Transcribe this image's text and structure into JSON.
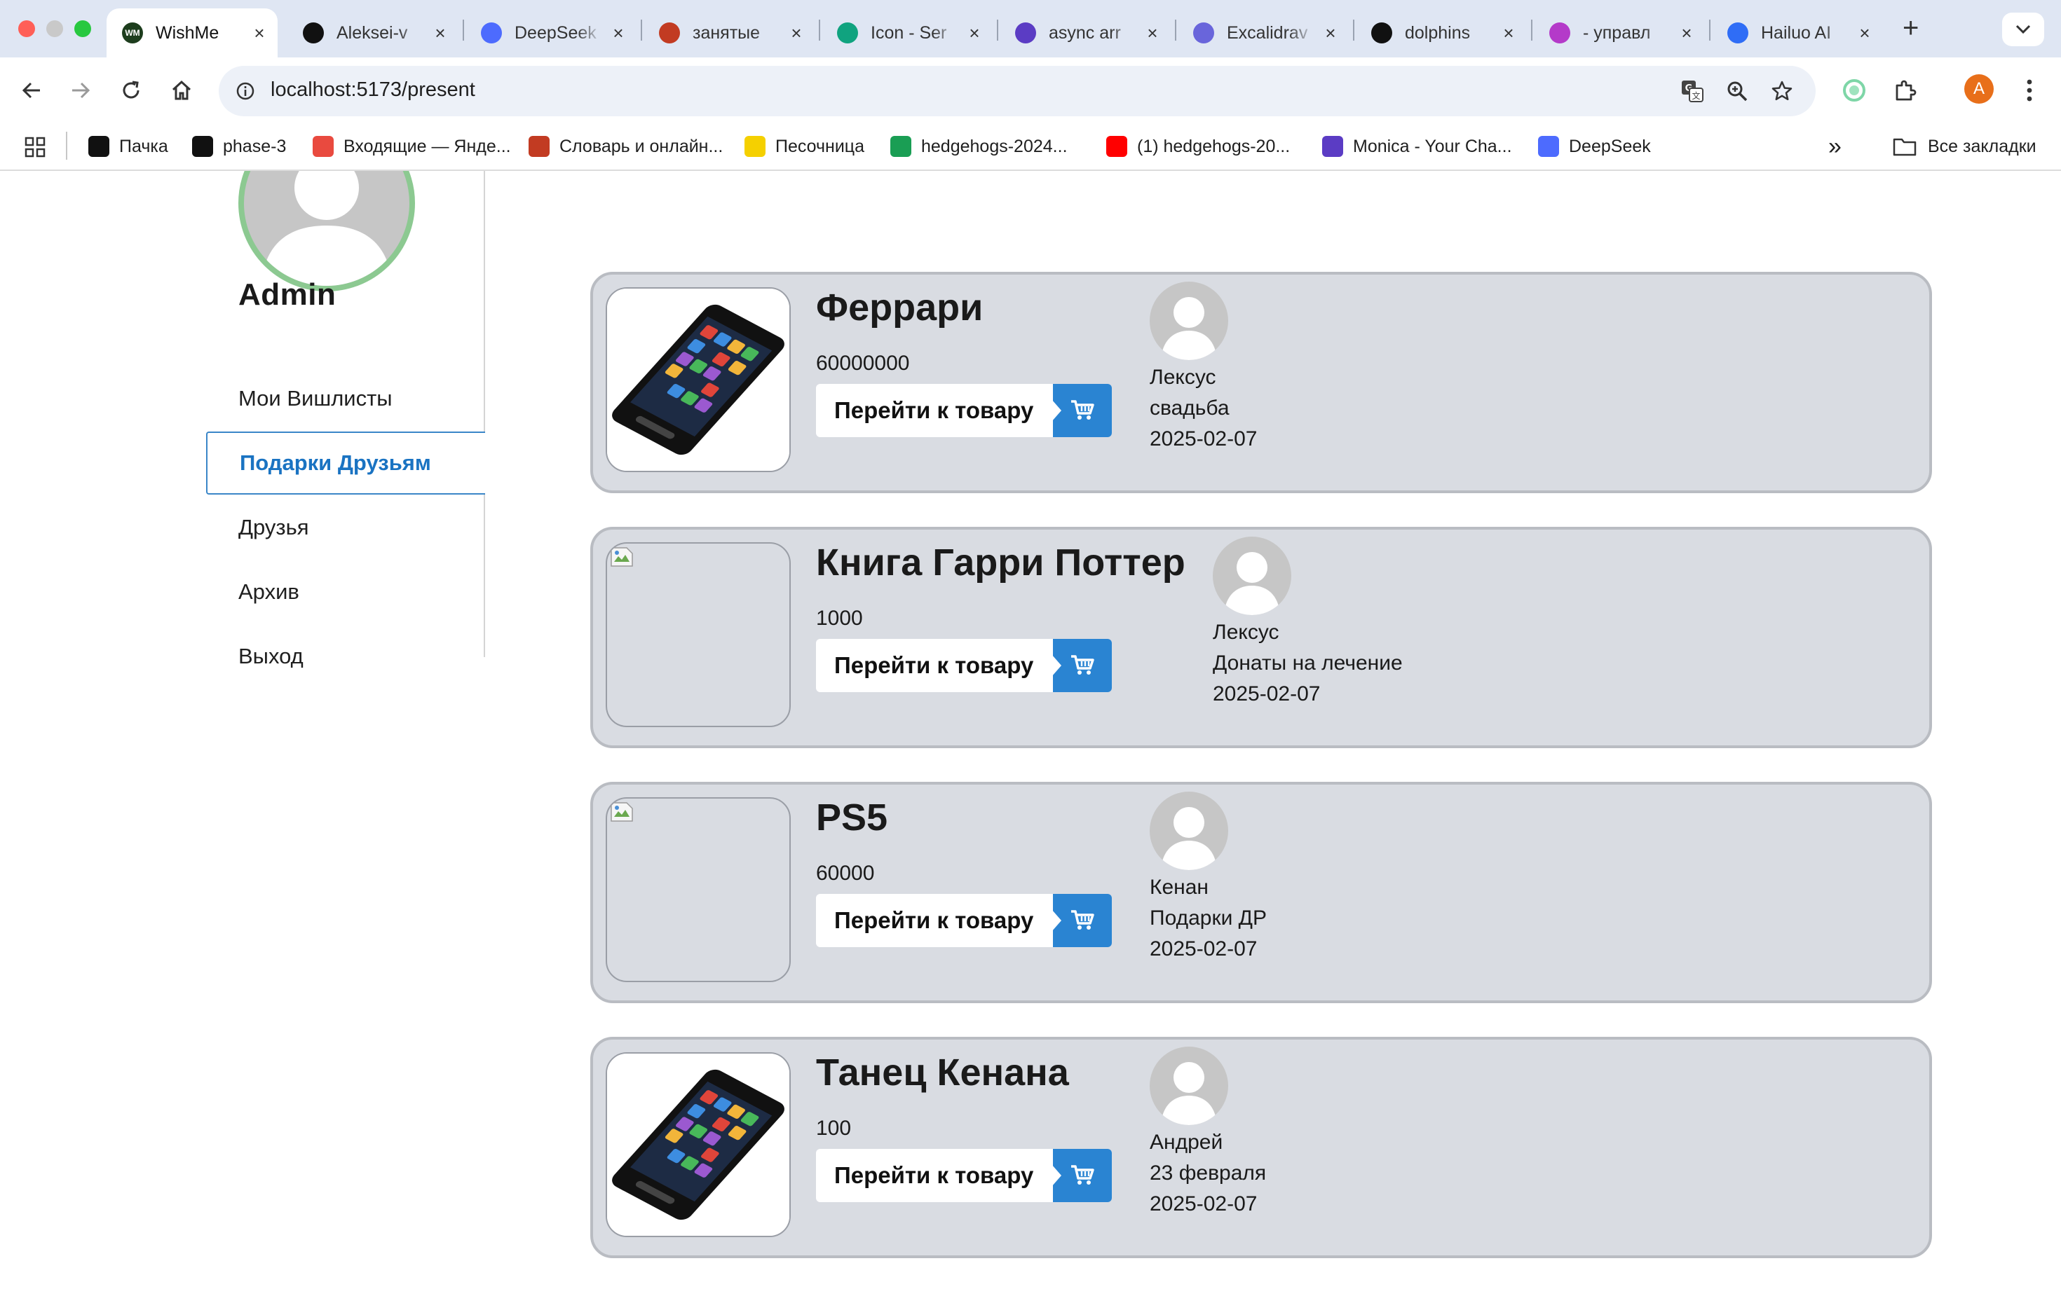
{
  "browser": {
    "tabs": [
      {
        "title": "WishMe",
        "favicon_color": "#1d3d1d",
        "favicon_text": "WM",
        "active": true
      },
      {
        "title": "Aleksei-v",
        "favicon_color": "#111111",
        "favicon_text": ""
      },
      {
        "title": "DeepSeek",
        "favicon_color": "#4d6bfe",
        "favicon_text": ""
      },
      {
        "title": "занятые",
        "favicon_color": "#c23b22",
        "favicon_text": ""
      },
      {
        "title": "Icon - Ser",
        "favicon_color": "#10a37f",
        "favicon_text": ""
      },
      {
        "title": "async arr",
        "favicon_color": "#5b3cc4",
        "favicon_text": ""
      },
      {
        "title": "Excalidrav",
        "favicon_color": "#6965db",
        "favicon_text": ""
      },
      {
        "title": "dolphins",
        "favicon_color": "#111111",
        "favicon_text": ""
      },
      {
        "title": "- управл",
        "favicon_color": "#b43ac9",
        "favicon_text": ""
      },
      {
        "title": "Hailuo AI",
        "favicon_color": "#2f6df6",
        "favicon_text": ""
      }
    ],
    "address": "localhost:5173/present",
    "profile_initial": "A",
    "bookmarks": [
      {
        "label": "Пачка",
        "color": "#111111"
      },
      {
        "label": "phase-3",
        "color": "#111111"
      },
      {
        "label": "Входящие — Янде...",
        "color": "#e94a3f"
      },
      {
        "label": "Словарь и онлайн...",
        "color": "#c23b22"
      },
      {
        "label": "Песочница",
        "color": "#f5d000"
      },
      {
        "label": "hedgehogs-2024...",
        "color": "#1a9e54"
      },
      {
        "label": "(1) hedgehogs-20...",
        "color": "#ff0000"
      },
      {
        "label": "Monica - Your Cha...",
        "color": "#5b3cc4"
      },
      {
        "label": "DeepSeek",
        "color": "#4d6bfe"
      }
    ],
    "all_bookmarks": "Все закладки",
    "overflow_glyph": "»"
  },
  "sidebar": {
    "username": "Admin",
    "menu": [
      {
        "label": "Мои Вишлисты",
        "active": false
      },
      {
        "label": "Подарки Друзьям",
        "active": true
      },
      {
        "label": "Друзья",
        "active": false
      },
      {
        "label": "Архив",
        "active": false
      },
      {
        "label": "Выход",
        "active": false
      }
    ]
  },
  "gifts": [
    {
      "title": "Феррари",
      "price": "60000000",
      "button": "Перейти к товару",
      "image": "phone",
      "owner": "Лексус",
      "list": "свадьба",
      "date": "2025-02-07"
    },
    {
      "title": "Книга Гарри Поттер",
      "price": "1000",
      "button": "Перейти к товару",
      "image": "broken",
      "owner": "Лексус",
      "list": "Донаты на лечение",
      "date": "2025-02-07"
    },
    {
      "title": "PS5",
      "price": "60000",
      "button": "Перейти к товару",
      "image": "broken",
      "owner": "Кенан",
      "list": "Подарки ДР",
      "date": "2025-02-07"
    },
    {
      "title": "Танец Кенана",
      "price": "100",
      "button": "Перейти к товару",
      "image": "phone",
      "owner": "Андрей",
      "list": "23 февраля",
      "date": "2025-02-07"
    }
  ],
  "colors": {
    "accent": "#2a84d2",
    "card_bg": "#d9dce2",
    "avatar_ring": "#8cc991"
  }
}
